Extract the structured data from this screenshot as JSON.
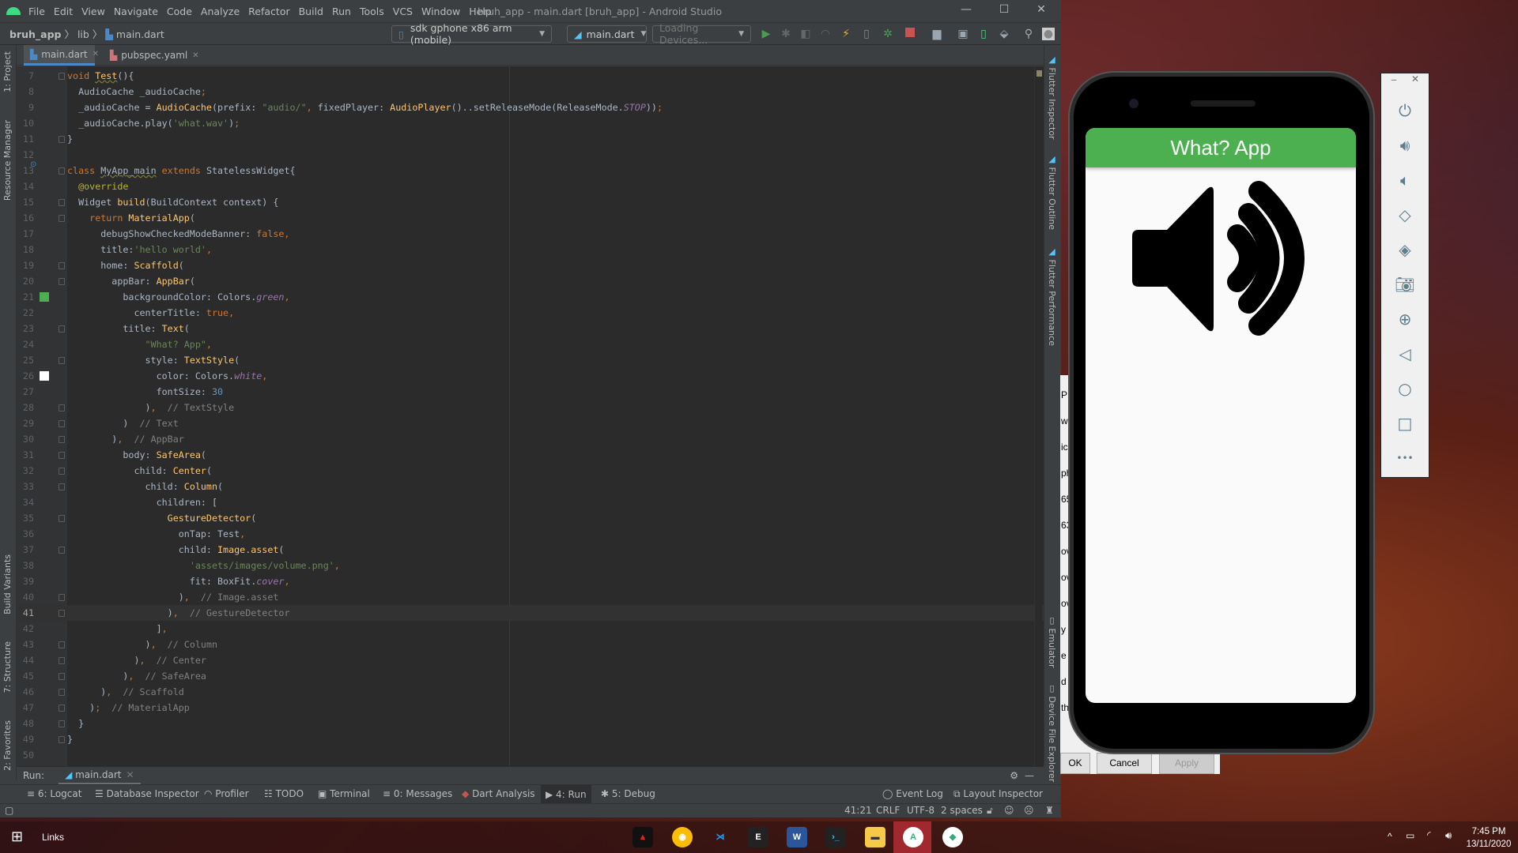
{
  "window": {
    "title": "bruh_app - main.dart [bruh_app] - Android Studio",
    "minimize": "—",
    "maximize": "☐",
    "close": "✕"
  },
  "menu": [
    "File",
    "Edit",
    "View",
    "Navigate",
    "Code",
    "Analyze",
    "Refactor",
    "Build",
    "Run",
    "Tools",
    "VCS",
    "Window",
    "Help"
  ],
  "breadcrumb": {
    "project": "bruh_app",
    "folder": "lib",
    "file": "main.dart"
  },
  "toolbar": {
    "device": "sdk gphone x86 arm (mobile)",
    "config": "main.dart",
    "devices": "Loading Devices..."
  },
  "tabs": [
    {
      "label": "main.dart",
      "active": true
    },
    {
      "label": "pubspec.yaml",
      "active": false
    }
  ],
  "left_tools": [
    "1: Project",
    "Resource Manager",
    "Build Variants",
    "7: Structure",
    "2: Favorites"
  ],
  "right_tools": [
    "Flutter Inspector",
    "Flutter Outline",
    "Flutter Performance",
    "Emulator",
    "Device File Explorer"
  ],
  "editor": {
    "current_line": 41,
    "swatches": {
      "21": "#4caf50",
      "26": "#ffffff"
    },
    "lines": [
      {
        "n": 7,
        "f": 1,
        "t": [
          [
            "void ",
            "kw"
          ],
          [
            "Test",
            "fn wavy"
          ],
          [
            "(){",
            ""
          ]
        ]
      },
      {
        "n": 8,
        "t": [
          [
            "  AudioCache _audioCache",
            ""
          ],
          [
            ";",
            "kw"
          ]
        ]
      },
      {
        "n": 9,
        "t": [
          [
            "  _audioCache = ",
            ""
          ],
          [
            "AudioCache",
            "fn"
          ],
          [
            "(prefix: ",
            ""
          ],
          [
            "\"audio/\"",
            "str"
          ],
          [
            ", ",
            "kw"
          ],
          [
            "fixedPlayer: ",
            ""
          ],
          [
            "AudioPlayer",
            "fn"
          ],
          [
            "()..setReleaseMode(ReleaseMode.",
            ""
          ],
          [
            "STOP",
            "const"
          ],
          [
            "))",
            ""
          ],
          [
            ";",
            "kw"
          ]
        ]
      },
      {
        "n": 10,
        "t": [
          [
            "  _audioCache.play(",
            ""
          ],
          [
            "'what.wav'",
            "str"
          ],
          [
            ")",
            ""
          ],
          [
            ";",
            "kw"
          ]
        ]
      },
      {
        "n": 11,
        "f": 1,
        "t": [
          [
            "}",
            ""
          ]
        ]
      },
      {
        "n": 12,
        "t": []
      },
      {
        "n": 13,
        "f": 1,
        "t": [
          [
            "class ",
            "kw"
          ],
          [
            "MyApp_main",
            "wavy"
          ],
          [
            " extends ",
            "kw"
          ],
          [
            "StatelessWidget{",
            ""
          ]
        ]
      },
      {
        "n": 14,
        "t": [
          [
            "  ",
            ""
          ],
          [
            "@override",
            "ann"
          ]
        ]
      },
      {
        "n": 15,
        "f": 1,
        "t": [
          [
            "  Widget ",
            ""
          ],
          [
            "build",
            "fn"
          ],
          [
            "(BuildContext context) {",
            ""
          ]
        ]
      },
      {
        "n": 16,
        "f": 1,
        "t": [
          [
            "    ",
            ""
          ],
          [
            "return ",
            "kw"
          ],
          [
            "MaterialApp",
            "fn"
          ],
          [
            "(",
            ""
          ]
        ]
      },
      {
        "n": 17,
        "t": [
          [
            "      debugShowCheckedModeBanner: ",
            ""
          ],
          [
            "false,",
            "kw"
          ]
        ]
      },
      {
        "n": 18,
        "t": [
          [
            "      title:",
            ""
          ],
          [
            "'hello world'",
            "str"
          ],
          [
            ",",
            "kw"
          ]
        ]
      },
      {
        "n": 19,
        "f": 1,
        "t": [
          [
            "      home: ",
            ""
          ],
          [
            "Scaffold",
            "fn"
          ],
          [
            "(",
            ""
          ]
        ]
      },
      {
        "n": 20,
        "f": 1,
        "t": [
          [
            "        appBar: ",
            ""
          ],
          [
            "AppBar",
            "fn"
          ],
          [
            "(",
            ""
          ]
        ]
      },
      {
        "n": 21,
        "t": [
          [
            "          backgroundColor: Colors.",
            ""
          ],
          [
            "green",
            "const"
          ],
          [
            ",",
            "kw"
          ]
        ]
      },
      {
        "n": 22,
        "t": [
          [
            "            centerTitle: ",
            ""
          ],
          [
            "true,",
            "kw"
          ]
        ]
      },
      {
        "n": 23,
        "f": 1,
        "t": [
          [
            "          title: ",
            ""
          ],
          [
            "Text",
            "fn"
          ],
          [
            "(",
            ""
          ]
        ]
      },
      {
        "n": 24,
        "t": [
          [
            "              ",
            ""
          ],
          [
            "\"What? App\"",
            "str"
          ],
          [
            ",",
            "kw"
          ]
        ]
      },
      {
        "n": 25,
        "f": 1,
        "t": [
          [
            "              style: ",
            ""
          ],
          [
            "TextStyle",
            "fn"
          ],
          [
            "(",
            ""
          ]
        ]
      },
      {
        "n": 26,
        "t": [
          [
            "                color: Colors.",
            ""
          ],
          [
            "white",
            "const"
          ],
          [
            ",",
            "kw"
          ]
        ]
      },
      {
        "n": 27,
        "t": [
          [
            "                fontSize: ",
            ""
          ],
          [
            "30",
            "num"
          ]
        ]
      },
      {
        "n": 28,
        "f": 1,
        "t": [
          [
            "              )",
            ""
          ],
          [
            ",",
            "kw"
          ],
          [
            "  // TextStyle",
            "cm"
          ]
        ]
      },
      {
        "n": 29,
        "f": 1,
        "t": [
          [
            "          )",
            ""
          ],
          [
            "  // Text",
            "cm"
          ]
        ]
      },
      {
        "n": 30,
        "f": 1,
        "t": [
          [
            "        )",
            ""
          ],
          [
            ",",
            "kw"
          ],
          [
            "  // AppBar",
            "cm"
          ]
        ]
      },
      {
        "n": 31,
        "f": 1,
        "t": [
          [
            "          body: ",
            ""
          ],
          [
            "SafeArea",
            "fn"
          ],
          [
            "(",
            ""
          ]
        ]
      },
      {
        "n": 32,
        "f": 1,
        "t": [
          [
            "            child: ",
            ""
          ],
          [
            "Center",
            "fn"
          ],
          [
            "(",
            ""
          ]
        ]
      },
      {
        "n": 33,
        "f": 1,
        "t": [
          [
            "              child: ",
            ""
          ],
          [
            "Column",
            "fn"
          ],
          [
            "(",
            ""
          ]
        ]
      },
      {
        "n": 34,
        "t": [
          [
            "                children: [",
            ""
          ]
        ]
      },
      {
        "n": 35,
        "f": 1,
        "t": [
          [
            "                  ",
            ""
          ],
          [
            "GestureDetector",
            "fn"
          ],
          [
            "(",
            ""
          ]
        ]
      },
      {
        "n": 36,
        "t": [
          [
            "                    onTap: Test",
            ""
          ],
          [
            ",",
            "kw"
          ]
        ]
      },
      {
        "n": 37,
        "f": 1,
        "t": [
          [
            "                    child: ",
            ""
          ],
          [
            "Image",
            "fn"
          ],
          [
            ".",
            ""
          ],
          [
            "asset",
            "fn"
          ],
          [
            "(",
            ""
          ]
        ]
      },
      {
        "n": 38,
        "t": [
          [
            "                      ",
            ""
          ],
          [
            "'assets/images/volume.png'",
            "str"
          ],
          [
            ",",
            "kw"
          ]
        ]
      },
      {
        "n": 39,
        "t": [
          [
            "                      fit: BoxFit.",
            ""
          ],
          [
            "cover",
            "const"
          ],
          [
            ",",
            "kw"
          ]
        ]
      },
      {
        "n": 40,
        "f": 1,
        "t": [
          [
            "                    )",
            ""
          ],
          [
            ",",
            "kw"
          ],
          [
            "  // Image.asset",
            "cm"
          ]
        ]
      },
      {
        "n": 41,
        "f": 1,
        "t": [
          [
            "                  )",
            ""
          ],
          [
            ",",
            "kw"
          ],
          [
            "  // GestureDetector",
            "cm"
          ]
        ]
      },
      {
        "n": 42,
        "t": [
          [
            "                ]",
            ""
          ],
          [
            ",",
            "kw"
          ]
        ]
      },
      {
        "n": 43,
        "f": 1,
        "t": [
          [
            "              )",
            ""
          ],
          [
            ",",
            "kw"
          ],
          [
            "  // Column",
            "cm"
          ]
        ]
      },
      {
        "n": 44,
        "f": 1,
        "t": [
          [
            "            )",
            ""
          ],
          [
            ",",
            "kw"
          ],
          [
            "  // Center",
            "cm"
          ]
        ]
      },
      {
        "n": 45,
        "f": 1,
        "t": [
          [
            "          )",
            ""
          ],
          [
            ",",
            "kw"
          ],
          [
            "  // SafeArea",
            "cm"
          ]
        ]
      },
      {
        "n": 46,
        "f": 1,
        "t": [
          [
            "      )",
            ""
          ],
          [
            ",",
            "kw"
          ],
          [
            "  // Scaffold",
            "cm"
          ]
        ]
      },
      {
        "n": 47,
        "f": 1,
        "t": [
          [
            "    )",
            ""
          ],
          [
            ";",
            "kw"
          ],
          [
            "  // MaterialApp",
            "cm"
          ]
        ]
      },
      {
        "n": 48,
        "f": 1,
        "t": [
          [
            "  }",
            ""
          ]
        ]
      },
      {
        "n": 49,
        "f": 1,
        "t": [
          [
            "}",
            ""
          ]
        ]
      },
      {
        "n": 50,
        "t": []
      }
    ]
  },
  "run": {
    "label": "Run:",
    "tab": "main.dart"
  },
  "tool_tabs": {
    "logcat": "6: Logcat",
    "db": "Database Inspector",
    "profiler": "Profiler",
    "todo": "TODO",
    "terminal": "Terminal",
    "messages": "0: Messages",
    "dart": "Dart Analysis",
    "run": "4: Run",
    "debug": "5: Debug",
    "eventlog": "Event Log",
    "layout": "Layout Inspector"
  },
  "status": {
    "position": "41:21",
    "line_sep": "CRLF",
    "encoding": "UTF-8",
    "indent": "2 spaces"
  },
  "dialog": {
    "fragments": [
      "P",
      "wav",
      "ic",
      "pha",
      "65",
      "63",
      "ov",
      "ov",
      "ov",
      "y",
      "e f",
      "d r",
      "thi"
    ],
    "ok": "OK",
    "cancel": "Cancel",
    "apply": "Apply"
  },
  "app": {
    "title": "What? App",
    "appbar_color": "#4caf50"
  },
  "emulator_toolbar": [
    "power",
    "volume-up",
    "volume-down",
    "rotate-left",
    "rotate-right",
    "screenshot",
    "zoom",
    "back",
    "home",
    "overview",
    "more"
  ],
  "taskbar": {
    "links": "Links",
    "time": "7:45 PM",
    "date": "13/11/2020",
    "apps": [
      "msi-dragon",
      "chrome",
      "vscode",
      "epic-games",
      "word",
      "terminal",
      "file-explorer",
      "android-studio",
      "android-studio-alt"
    ]
  }
}
